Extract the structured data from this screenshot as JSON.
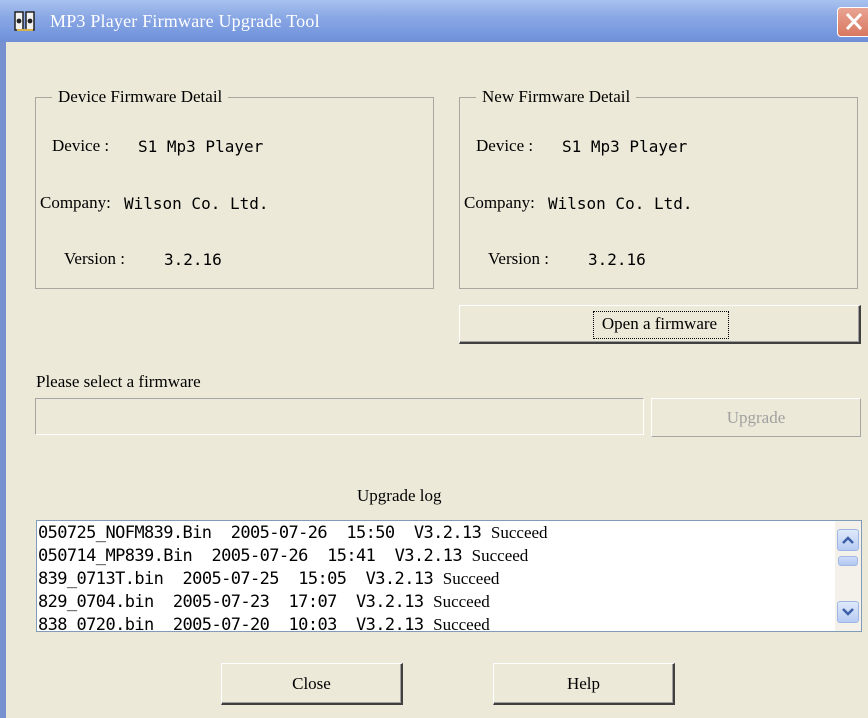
{
  "window": {
    "title": "MP3 Player Firmware Upgrade Tool"
  },
  "device_group": {
    "legend": "Device Firmware Detail",
    "device_label": "Device :",
    "device_value": "S1 Mp3 Player",
    "company_label": "Company:",
    "company_value": "Wilson Co. Ltd.",
    "version_label": "Version :",
    "version_value": "3.2.16"
  },
  "new_group": {
    "legend": "New Firmware Detail",
    "device_label": "Device :",
    "device_value": "S1 Mp3 Player",
    "company_label": "Company:",
    "company_value": "Wilson Co. Ltd.",
    "version_label": "Version :",
    "version_value": "3.2.16"
  },
  "open_button": "Open a firmware",
  "select_label": "Please select a firmware",
  "firmware_path": "",
  "upgrade_button": "Upgrade",
  "log": {
    "title": "Upgrade log",
    "rows": [
      {
        "file": "050725_NOFM839.Bin",
        "date": "2005-07-26",
        "time": "15:50",
        "version": "V3.2.13",
        "status": "Succeed"
      },
      {
        "file": "050714_MP839.Bin",
        "date": "2005-07-26",
        "time": "15:41",
        "version": "V3.2.13",
        "status": "Succeed"
      },
      {
        "file": "839_0713T.bin",
        "date": "2005-07-25",
        "time": "15:05",
        "version": "V3.2.13",
        "status": "Succeed"
      },
      {
        "file": "829_0704.bin",
        "date": "2005-07-23",
        "time": "17:07",
        "version": "V3.2.13",
        "status": "Succeed"
      },
      {
        "file": "838_0720.bin",
        "date": "2005-07-20",
        "time": "10:03",
        "version": "V3.2.13",
        "status": "Succeed"
      }
    ]
  },
  "close_button": "Close",
  "help_button": "Help",
  "icons": {
    "app": "speaker-app-icon",
    "close": "close-x-icon",
    "scroll_up": "chevron-up-icon",
    "scroll_down": "chevron-down-icon"
  },
  "colors": {
    "dialog_bg": "#ece9d8",
    "titlebar": "#8aa8e4",
    "close_button": "#d87860"
  }
}
